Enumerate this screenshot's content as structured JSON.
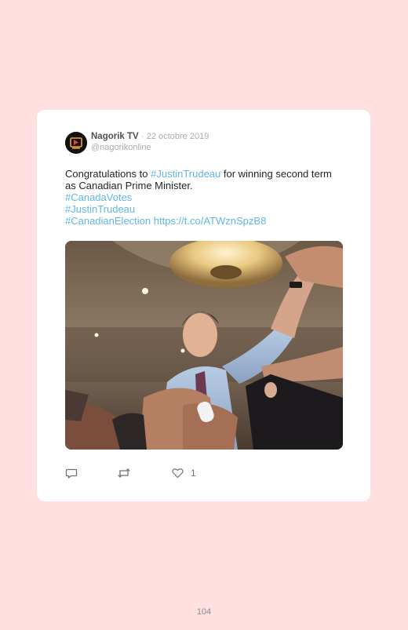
{
  "tweet": {
    "author_name": "Nagorik TV",
    "separator": "·",
    "date": "22 octobre 2019",
    "handle": "@nagorikonline",
    "text": {
      "line1_prefix": "Congratulations to ",
      "line1_hashtag": "#JustinTrudeau",
      "line1_suffix": " for winning second term",
      "line2": "as Canadian Prime Minister.",
      "hashtag_canada_votes": "#CanadaVotes",
      "hashtag_justin_trudeau": "#JustinTrudeau",
      "hashtag_canadian_election": "#CanadianElection",
      "link": "https://t.co/ATWznSpzB8"
    },
    "actions": {
      "reply_icon": "reply-icon",
      "retweet_icon": "retweet-icon",
      "like_icon": "heart-icon",
      "like_count": "1"
    }
  },
  "page": {
    "number": "104"
  },
  "colors": {
    "background": "#ffdfdf",
    "card": "#ffffff",
    "hashtag": "#5fb6e8",
    "text": "#1f2226"
  }
}
